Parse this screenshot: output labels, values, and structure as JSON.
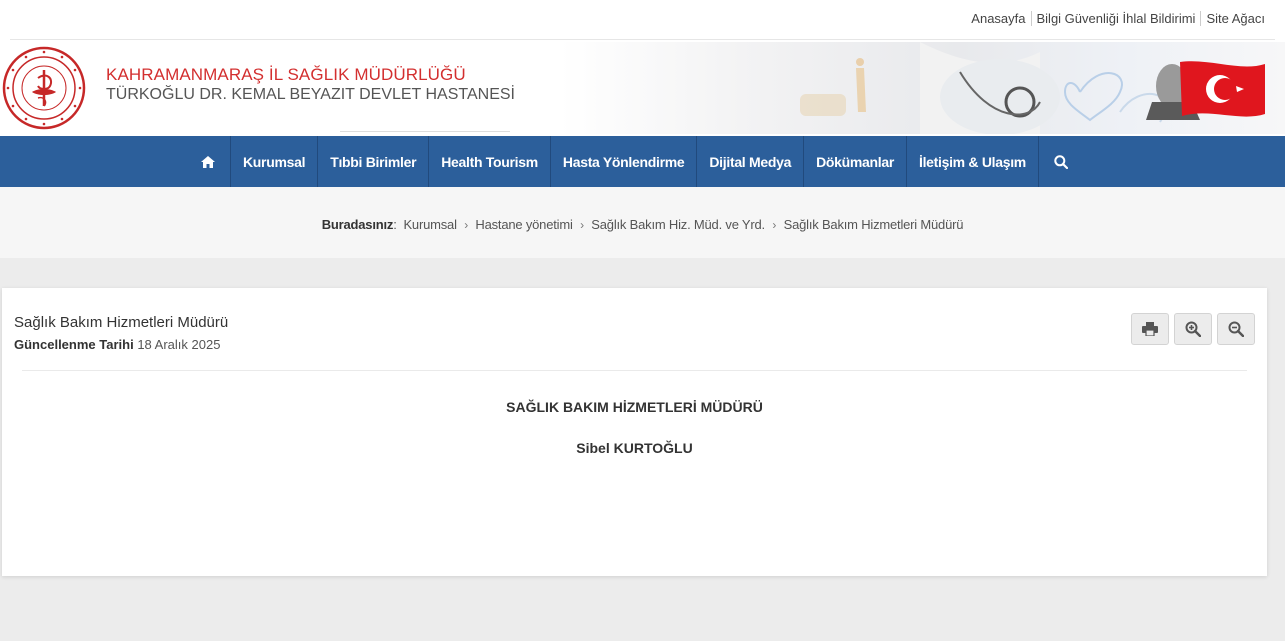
{
  "top_links": [
    "Anasayfa",
    "Bilgi Güvenliği İhlal Bildirimi",
    "Site Ağacı"
  ],
  "header": {
    "org_line1": "KAHRAMANMARAŞ İL SAĞLIK MÜDÜRLÜĞÜ",
    "org_line2": "TÜRKOĞLU DR. KEMAL BEYAZIT DEVLET HASTANESİ",
    "accent_color": "#d32f2f"
  },
  "nav": {
    "bg_color": "#2c5f9b",
    "items": [
      "Kurumsal",
      "Tıbbi Birimler",
      "Health Tourism",
      "Hasta Yönlendirme",
      "Dijital Medya",
      "Dökümanlar",
      "İletişim & Ulaşım"
    ]
  },
  "breadcrumb": {
    "label": "Buradasınız",
    "items": [
      "Kurumsal",
      "Hastane yönetimi",
      "Sağlık Bakım Hiz. Müd. ve Yrd.",
      "Sağlık Bakım Hizmetleri Müdürü"
    ]
  },
  "page": {
    "title": "Sağlık Bakım Hizmetleri Müdürü",
    "updated_label": "Güncellenme Tarihi",
    "updated_value": "18 Aralık 2025",
    "heading": "SAĞLIK BAKIM HİZMETLERİ MÜDÜRÜ",
    "name": "Sibel KURTOĞLU"
  },
  "icons": [
    "home-icon",
    "search-icon",
    "print-icon",
    "zoom-in-icon",
    "zoom-out-icon"
  ]
}
